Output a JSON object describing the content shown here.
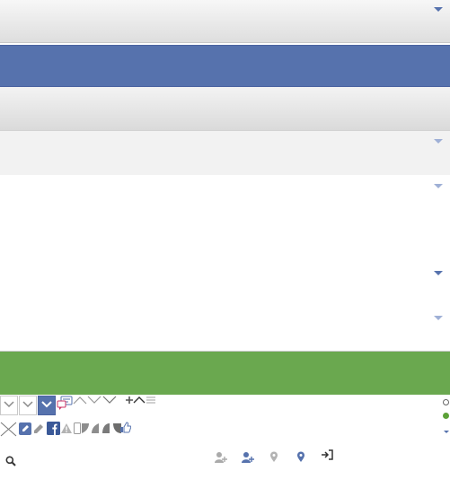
{
  "colors": {
    "brand_blue": "#5672ad",
    "green_bar": "#6aa84f",
    "toolbar_gray": "#dedede",
    "light_gray": "#f2f2f2",
    "status_green": "#5ca138"
  },
  "icons": [
    "chevron-down-icon",
    "chevron-down-icon",
    "chevron-down-icon",
    "chat-bubble-icon",
    "chevron-up-icon",
    "chevron-down-icon",
    "chevron-down-icon",
    "plus-icon",
    "chevron-up-icon",
    "list-icon",
    "close-icon",
    "edit-square-icon",
    "pencil-icon",
    "facebook-icon",
    "warning-icon",
    "phone-icon",
    "corner-shape-icon",
    "thumbs-up-icon",
    "search-icon",
    "add-user-icon",
    "add-user-icon",
    "map-pin-icon",
    "map-pin-icon",
    "login-icon",
    "radio-empty-icon",
    "status-dot-icon"
  ]
}
